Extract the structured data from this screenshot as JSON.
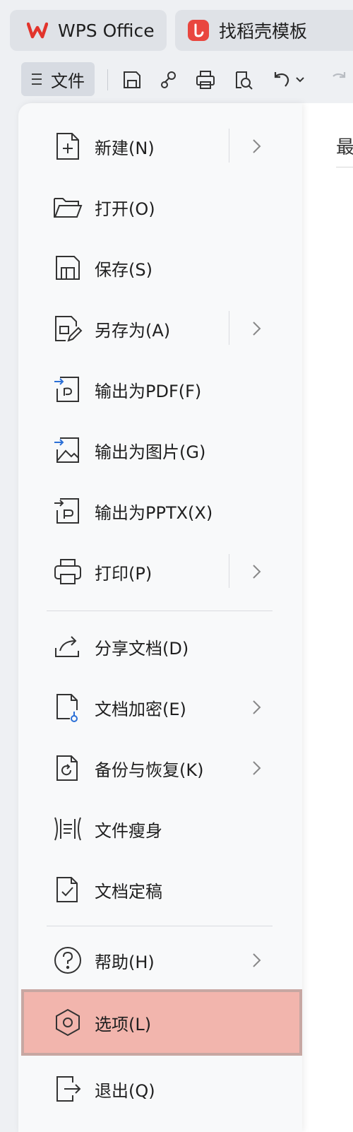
{
  "tabs": [
    {
      "label": "WPS Office",
      "icon": "wps-logo-icon"
    },
    {
      "label": "找稻壳模板",
      "icon": "docer-logo-icon"
    }
  ],
  "toolbar": {
    "file_label": "文件",
    "icons": [
      "save-icon",
      "share-link-icon",
      "print-icon",
      "print-preview-icon",
      "undo-icon",
      "dropdown-icon",
      "redo-icon"
    ]
  },
  "document": {
    "peek_text": "最"
  },
  "menu": {
    "items": [
      {
        "label": "新建(N)",
        "icon": "new-file-icon",
        "submenu": true
      },
      {
        "label": "打开(O)",
        "icon": "folder-open-icon",
        "submenu": false
      },
      {
        "label": "保存(S)",
        "icon": "save-icon",
        "submenu": false
      },
      {
        "label": "另存为(A)",
        "icon": "save-as-icon",
        "submenu": true
      },
      {
        "label": "输出为PDF(F)",
        "icon": "export-pdf-icon",
        "submenu": false
      },
      {
        "label": "输出为图片(G)",
        "icon": "export-image-icon",
        "submenu": false
      },
      {
        "label": "输出为PPTX(X)",
        "icon": "export-pptx-icon",
        "submenu": false
      },
      {
        "label": "打印(P)",
        "icon": "print-icon",
        "submenu": true
      },
      {
        "label": "分享文档(D)",
        "icon": "share-icon",
        "submenu": false
      },
      {
        "label": "文档加密(E)",
        "icon": "encrypt-icon",
        "submenu": true
      },
      {
        "label": "备份与恢复(K)",
        "icon": "backup-icon",
        "submenu": true
      },
      {
        "label": "文件瘦身",
        "icon": "compress-icon",
        "submenu": false
      },
      {
        "label": "文档定稿",
        "icon": "finalize-icon",
        "submenu": false
      },
      {
        "label": "帮助(H)",
        "icon": "help-icon",
        "submenu": true
      },
      {
        "label": "选项(L)",
        "icon": "options-icon",
        "submenu": false,
        "selected": true
      },
      {
        "label": "退出(Q)",
        "icon": "exit-icon",
        "submenu": false
      }
    ]
  },
  "colors": {
    "highlight": "#f2b5ad",
    "wps_brand": "#e2342c",
    "docer_brand": "#e9463f"
  }
}
